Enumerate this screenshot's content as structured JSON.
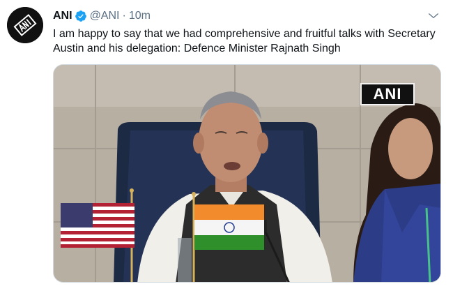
{
  "tweet": {
    "author_name": "ANI",
    "handle": "@ANI",
    "separator": "·",
    "timestamp": "10m",
    "text": "I am happy to say that we had comprehensive and fruitful talks with Secretary Austin and his delegation: Defence Minister Rajnath Singh",
    "avatar_logo_text": "ANI",
    "media_watermark": "ANI"
  },
  "icons": {
    "verified": "verified-badge-icon",
    "more": "more-options-icon"
  },
  "colors": {
    "verified": "#1da1f2",
    "secondary_text": "#5b7083",
    "primary_text": "#0f1419",
    "border": "#cfd9de"
  }
}
